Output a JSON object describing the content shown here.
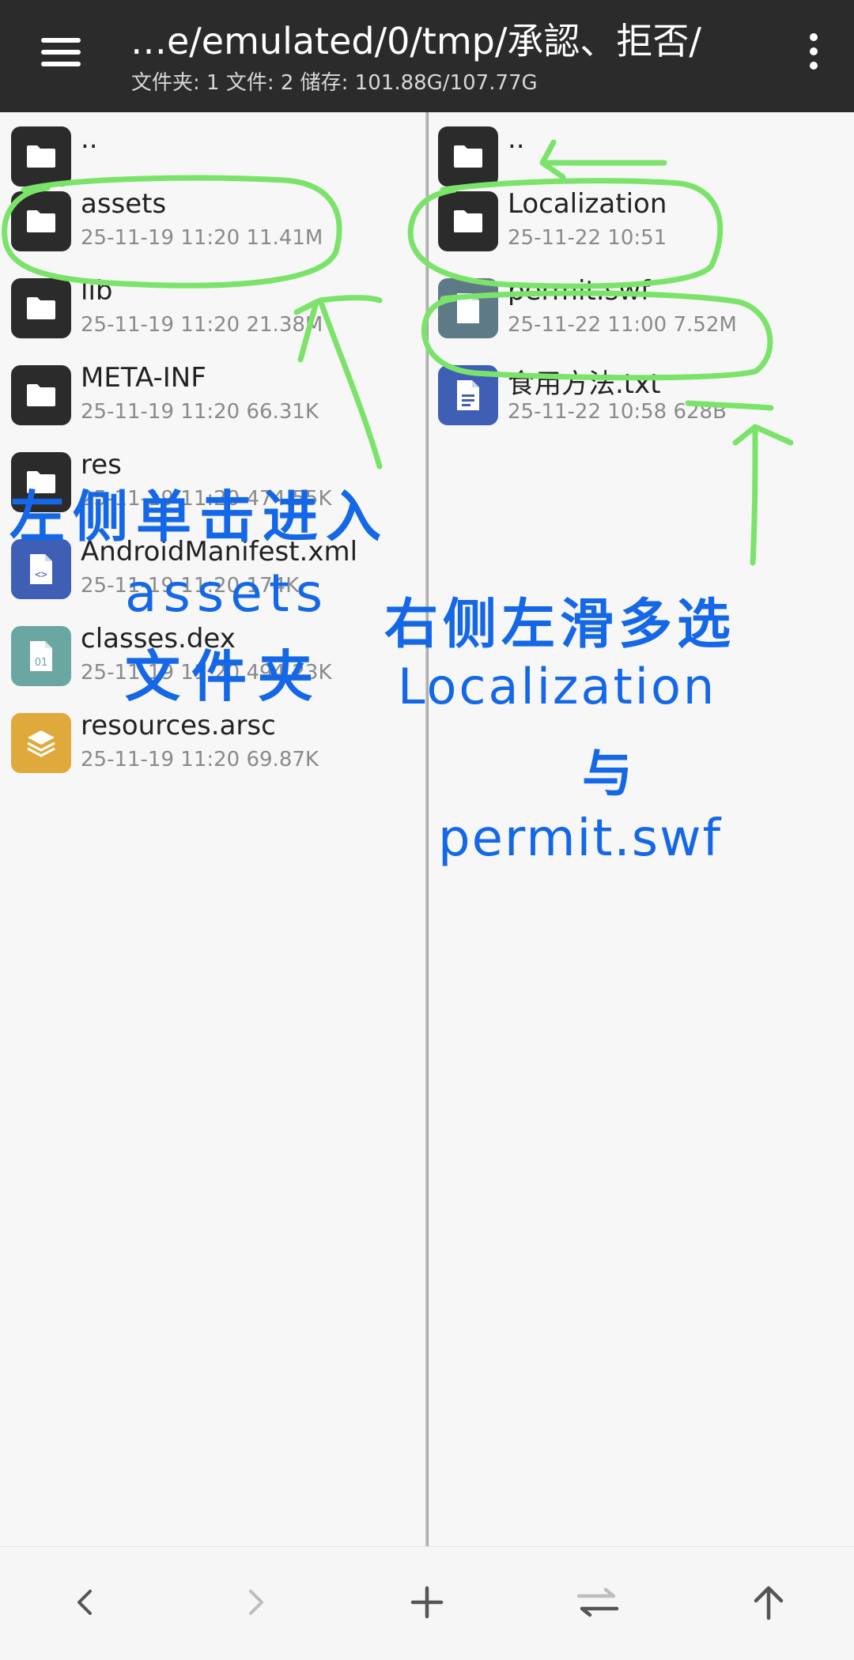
{
  "header": {
    "title": "…e/emulated/0/tmp/承認、拒否/",
    "subtitle": "文件夹: 1  文件: 2  储存: 101.88G/107.77G",
    "menu_icon": "hamburger-menu-icon",
    "more_icon": "more-vertical-icon"
  },
  "left_pane": {
    "items": [
      {
        "name": "..",
        "meta": "",
        "icon": "folder-icon"
      },
      {
        "name": "assets",
        "meta": "25-11-19 11:20  11.41M",
        "icon": "folder-icon"
      },
      {
        "name": "lib",
        "meta": "25-11-19 11:20  21.38M",
        "icon": "folder-icon"
      },
      {
        "name": "META-INF",
        "meta": "25-11-19 11:20  66.31K",
        "icon": "folder-icon"
      },
      {
        "name": "res",
        "meta": "25-11-19 11:20  474.55K",
        "icon": "folder-icon"
      },
      {
        "name": "AndroidManifest.xml",
        "meta": "25-11-19 11:20  174K",
        "icon": "xml-file-icon"
      },
      {
        "name": "classes.dex",
        "meta": "25-11-19 11:20  494.23K",
        "icon": "dex-file-icon"
      },
      {
        "name": "resources.arsc",
        "meta": "25-11-19 11:20  69.87K",
        "icon": "arsc-layers-icon"
      }
    ]
  },
  "right_pane": {
    "items": [
      {
        "name": "..",
        "meta": "",
        "icon": "folder-icon"
      },
      {
        "name": "Localization",
        "meta": "25-11-22 10:51",
        "icon": "folder-icon"
      },
      {
        "name": "permit.swf",
        "meta": "25-11-22 11:00  7.52M",
        "icon": "swf-file-icon"
      },
      {
        "name": "食用方法.txt",
        "meta": "25-11-22 10:58  628B",
        "icon": "txt-file-icon"
      }
    ]
  },
  "toolbar": {
    "back_icon": "chevron-left-icon",
    "forward_icon": "chevron-right-icon",
    "add_icon": "plus-icon",
    "swap_icon": "swap-arrows-icon",
    "up_icon": "arrow-up-icon"
  },
  "annotations": {
    "left_line1": "左侧单击进入",
    "left_line2": "assets",
    "left_line3": "文件夹",
    "right_line1": "右侧左滑多选",
    "right_line2": "Localization",
    "right_line3": "与",
    "right_line4": "permit.swf",
    "text_color": "#1467e6",
    "highlight_color": "#7be36a"
  },
  "colors": {
    "header_bg": "#2b2b2b",
    "folder_icon_bg": "#2b2b2b",
    "xml_icon_bg": "#3f5fb5",
    "dex_icon_bg": "#6aa7a0",
    "arsc_icon_bg": "#e0a93c",
    "swf_icon_bg": "#5f7a87"
  }
}
